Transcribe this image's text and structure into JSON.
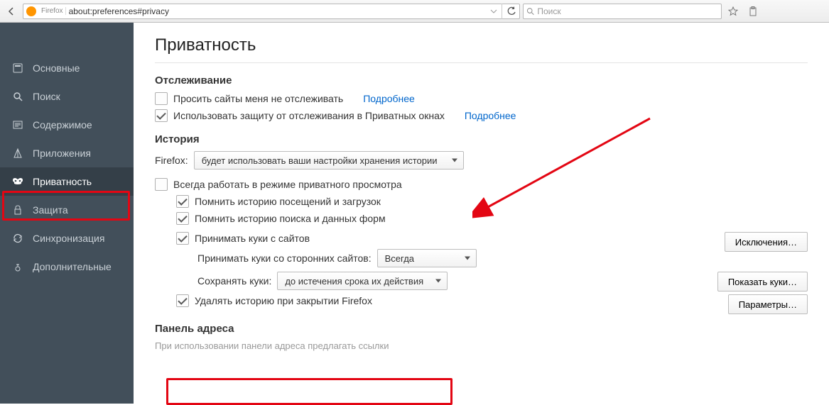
{
  "toolbar": {
    "identity_label": "Firefox",
    "url": "about:preferences#privacy",
    "search_placeholder": "Поиск"
  },
  "sidebar": {
    "items": [
      {
        "icon": "general-icon",
        "label": "Основные"
      },
      {
        "icon": "search-icon",
        "label": "Поиск"
      },
      {
        "icon": "content-icon",
        "label": "Содержимое"
      },
      {
        "icon": "apps-icon",
        "label": "Приложения"
      },
      {
        "icon": "privacy-icon",
        "label": "Приватность"
      },
      {
        "icon": "security-icon",
        "label": "Защита"
      },
      {
        "icon": "sync-icon",
        "label": "Синхронизация"
      },
      {
        "icon": "advanced-icon",
        "label": "Дополнительные"
      }
    ],
    "active_index": 4
  },
  "page": {
    "title": "Приватность",
    "tracking": {
      "heading": "Отслеживание",
      "dnt_label": "Просить сайты меня не отслеживать",
      "dnt_more": "Подробнее",
      "protection_label": "Использовать защиту от отслеживания в Приватных окнах",
      "protection_more": "Подробнее"
    },
    "history": {
      "heading": "История",
      "firefox_label": "Firefox:",
      "mode_select": "будет использовать ваши настройки хранения истории",
      "always_private": "Всегда работать в режиме приватного просмотра",
      "remember_browsing": "Помнить историю посещений и загрузок",
      "remember_forms": "Помнить историю поиска и данных форм",
      "accept_cookies": "Принимать куки с сайтов",
      "exceptions_btn": "Исключения…",
      "third_party_label": "Принимать куки со сторонних сайтов:",
      "third_party_value": "Всегда",
      "keep_until_label": "Сохранять куки:",
      "keep_until_value": "до истечения срока их действия",
      "show_cookies_btn": "Показать куки…",
      "clear_on_close": "Удалять историю при закрытии Firefox",
      "settings_btn": "Параметры…"
    },
    "addressbar": {
      "heading": "Панель адреса",
      "truncated_text": "При использовании панели адреса предлагать ссылки"
    }
  }
}
